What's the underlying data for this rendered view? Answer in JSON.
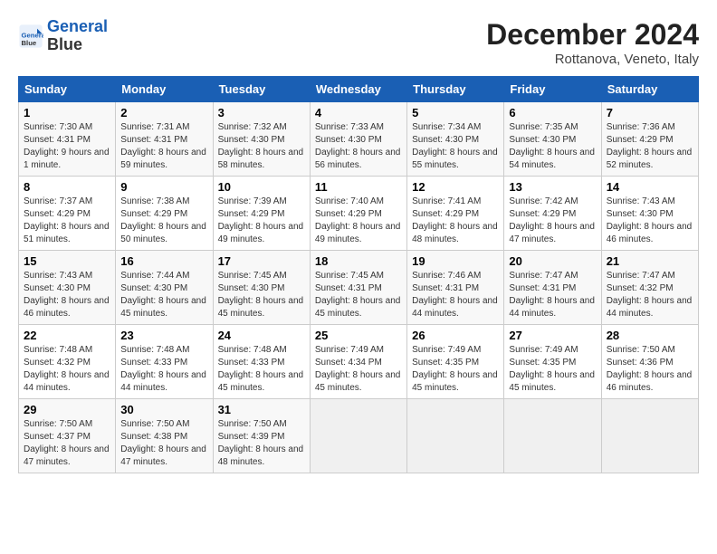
{
  "header": {
    "logo_line1": "General",
    "logo_line2": "Blue",
    "month_year": "December 2024",
    "location": "Rottanova, Veneto, Italy"
  },
  "weekdays": [
    "Sunday",
    "Monday",
    "Tuesday",
    "Wednesday",
    "Thursday",
    "Friday",
    "Saturday"
  ],
  "weeks": [
    [
      {
        "day": "1",
        "sunrise": "Sunrise: 7:30 AM",
        "sunset": "Sunset: 4:31 PM",
        "daylight": "Daylight: 9 hours and 1 minute."
      },
      {
        "day": "2",
        "sunrise": "Sunrise: 7:31 AM",
        "sunset": "Sunset: 4:31 PM",
        "daylight": "Daylight: 8 hours and 59 minutes."
      },
      {
        "day": "3",
        "sunrise": "Sunrise: 7:32 AM",
        "sunset": "Sunset: 4:30 PM",
        "daylight": "Daylight: 8 hours and 58 minutes."
      },
      {
        "day": "4",
        "sunrise": "Sunrise: 7:33 AM",
        "sunset": "Sunset: 4:30 PM",
        "daylight": "Daylight: 8 hours and 56 minutes."
      },
      {
        "day": "5",
        "sunrise": "Sunrise: 7:34 AM",
        "sunset": "Sunset: 4:30 PM",
        "daylight": "Daylight: 8 hours and 55 minutes."
      },
      {
        "day": "6",
        "sunrise": "Sunrise: 7:35 AM",
        "sunset": "Sunset: 4:30 PM",
        "daylight": "Daylight: 8 hours and 54 minutes."
      },
      {
        "day": "7",
        "sunrise": "Sunrise: 7:36 AM",
        "sunset": "Sunset: 4:29 PM",
        "daylight": "Daylight: 8 hours and 52 minutes."
      }
    ],
    [
      {
        "day": "8",
        "sunrise": "Sunrise: 7:37 AM",
        "sunset": "Sunset: 4:29 PM",
        "daylight": "Daylight: 8 hours and 51 minutes."
      },
      {
        "day": "9",
        "sunrise": "Sunrise: 7:38 AM",
        "sunset": "Sunset: 4:29 PM",
        "daylight": "Daylight: 8 hours and 50 minutes."
      },
      {
        "day": "10",
        "sunrise": "Sunrise: 7:39 AM",
        "sunset": "Sunset: 4:29 PM",
        "daylight": "Daylight: 8 hours and 49 minutes."
      },
      {
        "day": "11",
        "sunrise": "Sunrise: 7:40 AM",
        "sunset": "Sunset: 4:29 PM",
        "daylight": "Daylight: 8 hours and 49 minutes."
      },
      {
        "day": "12",
        "sunrise": "Sunrise: 7:41 AM",
        "sunset": "Sunset: 4:29 PM",
        "daylight": "Daylight: 8 hours and 48 minutes."
      },
      {
        "day": "13",
        "sunrise": "Sunrise: 7:42 AM",
        "sunset": "Sunset: 4:29 PM",
        "daylight": "Daylight: 8 hours and 47 minutes."
      },
      {
        "day": "14",
        "sunrise": "Sunrise: 7:43 AM",
        "sunset": "Sunset: 4:30 PM",
        "daylight": "Daylight: 8 hours and 46 minutes."
      }
    ],
    [
      {
        "day": "15",
        "sunrise": "Sunrise: 7:43 AM",
        "sunset": "Sunset: 4:30 PM",
        "daylight": "Daylight: 8 hours and 46 minutes."
      },
      {
        "day": "16",
        "sunrise": "Sunrise: 7:44 AM",
        "sunset": "Sunset: 4:30 PM",
        "daylight": "Daylight: 8 hours and 45 minutes."
      },
      {
        "day": "17",
        "sunrise": "Sunrise: 7:45 AM",
        "sunset": "Sunset: 4:30 PM",
        "daylight": "Daylight: 8 hours and 45 minutes."
      },
      {
        "day": "18",
        "sunrise": "Sunrise: 7:45 AM",
        "sunset": "Sunset: 4:31 PM",
        "daylight": "Daylight: 8 hours and 45 minutes."
      },
      {
        "day": "19",
        "sunrise": "Sunrise: 7:46 AM",
        "sunset": "Sunset: 4:31 PM",
        "daylight": "Daylight: 8 hours and 44 minutes."
      },
      {
        "day": "20",
        "sunrise": "Sunrise: 7:47 AM",
        "sunset": "Sunset: 4:31 PM",
        "daylight": "Daylight: 8 hours and 44 minutes."
      },
      {
        "day": "21",
        "sunrise": "Sunrise: 7:47 AM",
        "sunset": "Sunset: 4:32 PM",
        "daylight": "Daylight: 8 hours and 44 minutes."
      }
    ],
    [
      {
        "day": "22",
        "sunrise": "Sunrise: 7:48 AM",
        "sunset": "Sunset: 4:32 PM",
        "daylight": "Daylight: 8 hours and 44 minutes."
      },
      {
        "day": "23",
        "sunrise": "Sunrise: 7:48 AM",
        "sunset": "Sunset: 4:33 PM",
        "daylight": "Daylight: 8 hours and 44 minutes."
      },
      {
        "day": "24",
        "sunrise": "Sunrise: 7:48 AM",
        "sunset": "Sunset: 4:33 PM",
        "daylight": "Daylight: 8 hours and 45 minutes."
      },
      {
        "day": "25",
        "sunrise": "Sunrise: 7:49 AM",
        "sunset": "Sunset: 4:34 PM",
        "daylight": "Daylight: 8 hours and 45 minutes."
      },
      {
        "day": "26",
        "sunrise": "Sunrise: 7:49 AM",
        "sunset": "Sunset: 4:35 PM",
        "daylight": "Daylight: 8 hours and 45 minutes."
      },
      {
        "day": "27",
        "sunrise": "Sunrise: 7:49 AM",
        "sunset": "Sunset: 4:35 PM",
        "daylight": "Daylight: 8 hours and 45 minutes."
      },
      {
        "day": "28",
        "sunrise": "Sunrise: 7:50 AM",
        "sunset": "Sunset: 4:36 PM",
        "daylight": "Daylight: 8 hours and 46 minutes."
      }
    ],
    [
      {
        "day": "29",
        "sunrise": "Sunrise: 7:50 AM",
        "sunset": "Sunset: 4:37 PM",
        "daylight": "Daylight: 8 hours and 47 minutes."
      },
      {
        "day": "30",
        "sunrise": "Sunrise: 7:50 AM",
        "sunset": "Sunset: 4:38 PM",
        "daylight": "Daylight: 8 hours and 47 minutes."
      },
      {
        "day": "31",
        "sunrise": "Sunrise: 7:50 AM",
        "sunset": "Sunset: 4:39 PM",
        "daylight": "Daylight: 8 hours and 48 minutes."
      },
      null,
      null,
      null,
      null
    ]
  ]
}
